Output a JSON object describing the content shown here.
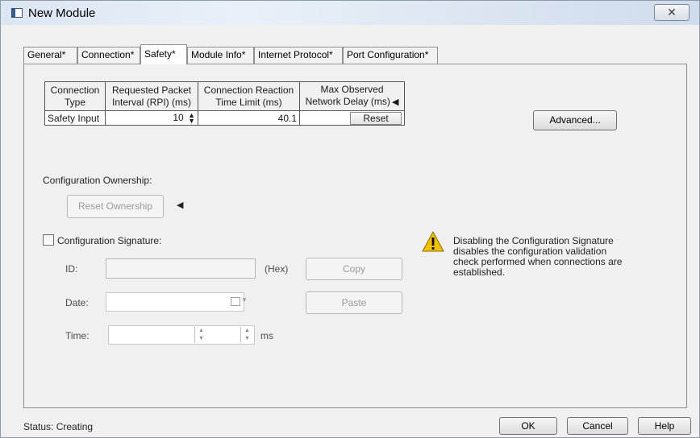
{
  "window": {
    "title": "New Module",
    "close_label": "✕"
  },
  "tabs": [
    {
      "label": "General*"
    },
    {
      "label": "Connection*"
    },
    {
      "label": "Safety*"
    },
    {
      "label": "Module Info*"
    },
    {
      "label": "Internet Protocol*"
    },
    {
      "label": "Port Configuration*"
    }
  ],
  "active_tab": "Safety*",
  "table": {
    "headers": {
      "type_l1": "Connection",
      "type_l2": "Type",
      "rpi_l1": "Requested Packet",
      "rpi_l2": "Interval (RPI) (ms)",
      "crtl_l1": "Connection Reaction",
      "crtl_l2": "Time Limit (ms)",
      "delay_l1": "Max Observed",
      "delay_l2": "Network Delay (ms)"
    },
    "row": {
      "type": "Safety Input",
      "rpi": "10",
      "crtl": "40.1",
      "delay": "",
      "reset_label": "Reset"
    }
  },
  "advanced_button": "Advanced...",
  "ownership": {
    "label": "Configuration Ownership:",
    "reset_button": "Reset Ownership"
  },
  "signature": {
    "checkbox_label": "Configuration Signature:",
    "checked": false,
    "id_label": "ID:",
    "id_value": "",
    "hex_label": "(Hex)",
    "copy_button": "Copy",
    "date_label": "Date:",
    "date_value": "",
    "paste_button": "Paste",
    "time_label": "Time:",
    "time_value": "",
    "ms_label": "ms"
  },
  "warning": {
    "icon": "warning-icon",
    "line1": "Disabling the Configuration Signature",
    "line2": "disables the configuration validation",
    "line3": "check performed when connections are",
    "line4": "established."
  },
  "status": {
    "text": "Status:  Creating"
  },
  "footer_buttons": {
    "ok": "OK",
    "cancel": "Cancel",
    "help": "Help"
  },
  "colors": {
    "titlebar": "#dbe6f3",
    "dialog_bg": "#f0f0f0",
    "warning_yellow": "#f2c200"
  }
}
